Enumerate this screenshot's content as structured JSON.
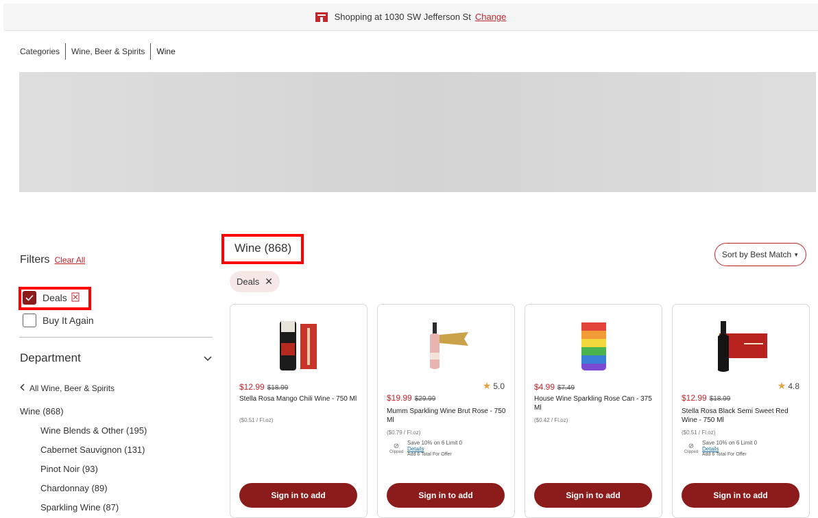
{
  "store_bar": {
    "text": "Shopping at 1030 SW Jefferson St",
    "change": "Change"
  },
  "breadcrumb": [
    "Categories",
    "Wine, Beer & Spirits",
    "Wine"
  ],
  "filters": {
    "title": "Filters",
    "clear_all": "Clear All",
    "options": [
      {
        "label": "Deals",
        "checked": true
      },
      {
        "label": "Buy It Again",
        "checked": false
      }
    ]
  },
  "department": {
    "title": "Department",
    "back": "All Wine, Beer & Spirits",
    "current": "Wine (868)",
    "subs": [
      "Wine Blends & Other (195)",
      "Cabernet Sauvignon (131)",
      "Pinot Noir (93)",
      "Chardonnay (89)",
      "Sparkling Wine (87)"
    ]
  },
  "main": {
    "title": "Wine (868)",
    "sort": "Sort by Best Match",
    "chip": "Deals"
  },
  "products": [
    {
      "price": "$12.99",
      "was": "$18.99",
      "name": "Stella Rosa Mango Chili Wine - 750 Ml",
      "unit": "($0.51 / Fl.oz)",
      "rating": "",
      "offer": null,
      "button": "Sign in to add"
    },
    {
      "price": "$19.99",
      "was": "$29.99",
      "name": "Mumm Sparkling Wine Brut Rose - 750 Ml",
      "unit": "($0.79 / Fl.oz)",
      "rating": "5.0",
      "offer": {
        "clipped": "Clipped",
        "text": "Save 10% on 6 Limit 0",
        "details": "Details",
        "total": "Add 6 Total For Offer"
      },
      "button": "Sign in to add"
    },
    {
      "price": "$4.99",
      "was": "$7.49",
      "name": "House Wine Sparkling Rose Can - 375 Ml",
      "unit": "($0.42 / Fl.oz)",
      "rating": "",
      "offer": null,
      "button": "Sign in to add"
    },
    {
      "price": "$12.99",
      "was": "$18.99",
      "name": "Stella Rosa Black Semi Sweet Red Wine - 750 Ml",
      "unit": "($0.51 / Fl.oz)",
      "rating": "4.8",
      "offer": {
        "clipped": "Clipped",
        "text": "Save 10% on 6 Limit 0",
        "details": "Details",
        "total": "Add 6 Total For Offer"
      },
      "button": "Sign in to add"
    }
  ],
  "colors": {
    "accent": "#c2272d",
    "button": "#8c1c1c",
    "chip_bg": "#f7e8e8",
    "highlight": "#ff0000"
  }
}
